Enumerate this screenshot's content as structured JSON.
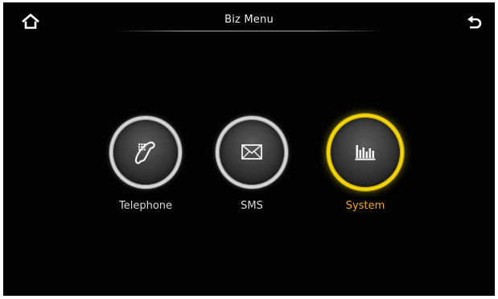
{
  "header": {
    "title": "Biz Menu",
    "home_icon": "home-icon",
    "back_icon": "back-arrow-icon"
  },
  "menu": {
    "items": [
      {
        "label": "Telephone",
        "icon": "phone-icon",
        "selected": false
      },
      {
        "label": "SMS",
        "icon": "envelope-icon",
        "selected": false
      },
      {
        "label": "System",
        "icon": "bar-chart-icon",
        "selected": true
      }
    ]
  },
  "colors": {
    "background": "#030303",
    "ring": "#d4d4d4",
    "selected_ring": "#f2d40a",
    "selected_label": "#f0a818",
    "label": "#d9d9d9"
  }
}
